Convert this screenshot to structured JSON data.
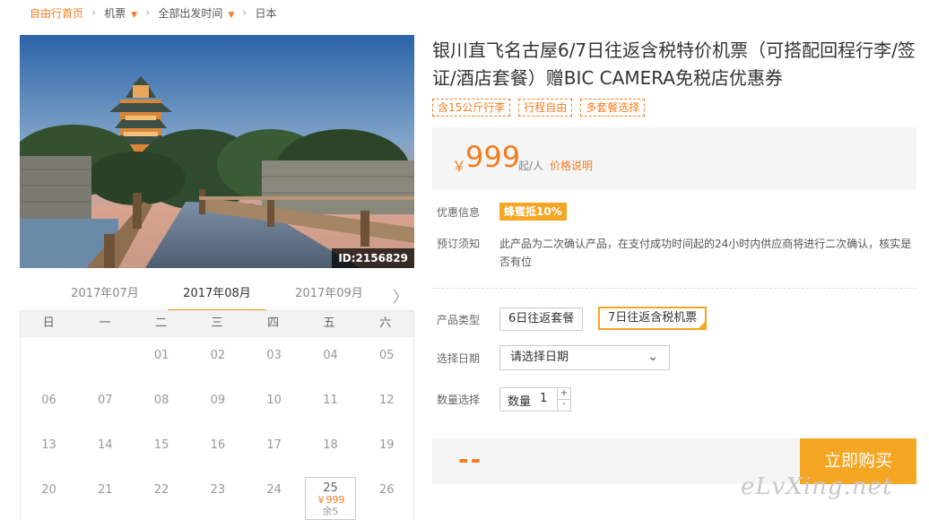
{
  "breadcrumb": {
    "home": "自由行首页",
    "items": [
      "机票",
      "全部出发时间",
      "日本"
    ]
  },
  "photo": {
    "id_label": "ID:2156829"
  },
  "calendar": {
    "months": [
      "2017年07月",
      "2017年08月",
      "2017年09月"
    ],
    "active_month": "2017年08月",
    "weekdays": [
      "日",
      "一",
      "二",
      "三",
      "四",
      "五",
      "六"
    ],
    "rows": [
      [
        "",
        "",
        "01",
        "02",
        "03",
        "04",
        "05"
      ],
      [
        "06",
        "07",
        "08",
        "09",
        "10",
        "11",
        "12"
      ],
      [
        "13",
        "14",
        "15",
        "16",
        "17",
        "18",
        "19"
      ],
      [
        "20",
        "21",
        "22",
        "23",
        "24",
        "25",
        "26"
      ]
    ],
    "selected_day": {
      "day": "25",
      "price": "￥999",
      "stock": "余5"
    }
  },
  "product": {
    "title": "银川直飞名古屋6/7日往返含税特价机票（可搭配回程行李/签证/酒店套餐）赠BIC CAMERA免税店优惠券",
    "tags": [
      "含15公斤行李",
      "行程自由",
      "多套餐选择"
    ],
    "price_symbol": "￥",
    "price": "999",
    "price_unit": "起/人",
    "price_link": "价格说明"
  },
  "info": {
    "promo_label": "优惠信息",
    "promo_badge": "蜂蜜抵10%",
    "notice_label": "预订须知",
    "notice_text": "此产品为二次确认产品，在支付成功时间起的24小时内供应商将进行二次确认，核实是否有位"
  },
  "options": {
    "type_label": "产品类型",
    "types": [
      "6日往返套餐",
      "7日往返含税机票"
    ],
    "selected_type": "7日往返含税机票",
    "date_label": "选择日期",
    "date_placeholder": "请选择日期",
    "qty_label": "数量选择",
    "qty_inner_label": "数量",
    "qty_value": "1"
  },
  "purchase": {
    "total": "--",
    "buy_label": "立即购买"
  },
  "watermark": "eLvXing.net",
  "colors": {
    "accent": "#f47c20",
    "button": "#f5a623"
  }
}
